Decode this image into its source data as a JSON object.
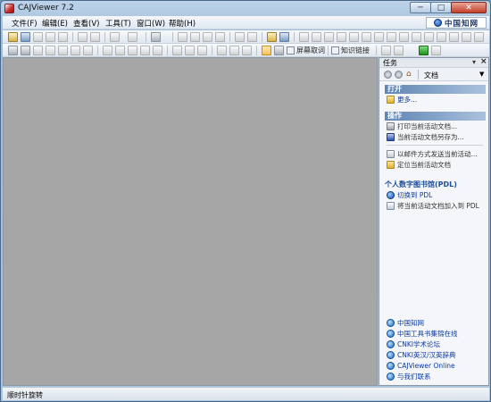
{
  "window": {
    "title": "CAJViewer 7.2",
    "logo_text": "中国知网"
  },
  "menu": [
    {
      "label": "文件(F)"
    },
    {
      "label": "编辑(E)"
    },
    {
      "label": "查看(V)"
    },
    {
      "label": "工具(T)"
    },
    {
      "label": "窗口(W)"
    },
    {
      "label": "帮助(H)"
    }
  ],
  "toolbar2": {
    "translate_label": "屏幕取词",
    "draw_label": "知识链接"
  },
  "task_panel": {
    "title": "任务",
    "nav_label": "文档",
    "sections": {
      "open": {
        "title": "打开",
        "items": [
          {
            "label": "更多...",
            "icon": "folder-icon"
          }
        ]
      },
      "operations": {
        "title": "操作",
        "items": [
          {
            "label": "打印当前活动文档...",
            "icon": "printer-icon"
          },
          {
            "label": "当前活动文档另存为...",
            "icon": "save-icon"
          }
        ],
        "items2": [
          {
            "label": "以邮件方式发送当前活动...",
            "icon": "mail-icon"
          },
          {
            "label": "定位当前活动文档",
            "icon": "folder-icon"
          }
        ]
      },
      "pdl": {
        "title": "个人数字图书馆(PDL)",
        "items": [
          {
            "label": "切换到 PDL",
            "icon": "globe-icon"
          },
          {
            "label": "将当前活动文档加入到 PDL",
            "icon": "add-document-icon"
          }
        ]
      }
    },
    "links": [
      {
        "label": "中国知网"
      },
      {
        "label": "中国工具书集锦在线"
      },
      {
        "label": "CNKI学术论坛"
      },
      {
        "label": "CNKI英汉/汉英辞典"
      },
      {
        "label": "CAJViewer Online"
      },
      {
        "label": "与我们联系"
      }
    ]
  },
  "status": {
    "text": "顺时针旋转"
  }
}
